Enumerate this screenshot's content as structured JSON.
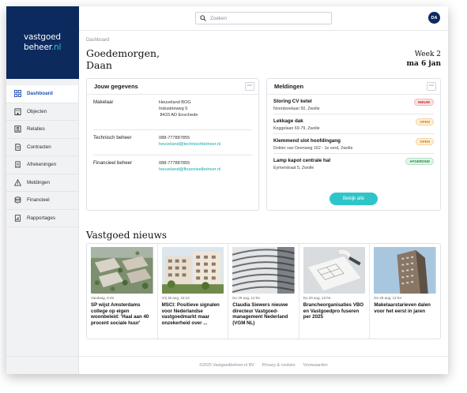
{
  "brand": {
    "line1": "vastgoed",
    "line2_main": "beheer",
    "line2_accent": ".nl"
  },
  "nav": [
    {
      "label": "Dashboard",
      "icon": "grid-icon",
      "active": true
    },
    {
      "label": "Objecten",
      "icon": "building-icon"
    },
    {
      "label": "Relaties",
      "icon": "contacts-icon"
    },
    {
      "label": "Contracten",
      "icon": "contract-icon"
    },
    {
      "label": "Afrekeningen",
      "icon": "receipt-icon"
    },
    {
      "label": "Meldingen",
      "icon": "warning-icon"
    },
    {
      "label": "Financieel",
      "icon": "coins-icon"
    },
    {
      "label": "Rapportages",
      "icon": "report-icon"
    }
  ],
  "search": {
    "placeholder": "Zoeken"
  },
  "user": {
    "initials": "DA"
  },
  "page": {
    "breadcrumb": "Dashboard",
    "greeting": "Goedemorgen, Daan",
    "week": "Week 2",
    "date": "ma 6 jan"
  },
  "gegevens": {
    "title": "Jouw gegevens",
    "more": "···",
    "rows": [
      {
        "label": "Makelaar",
        "lines": [
          "Heuveland BOG",
          "Industrieweg 5",
          " 8433 AD Enschede"
        ]
      },
      {
        "label": "Technisch beheer",
        "lines": [
          "088-777887855"
        ],
        "link": "heuveland@technischbeheer.nl"
      },
      {
        "label": "Financieel beheer",
        "lines": [
          "088-777887855"
        ],
        "link": "heuveland@financieelbeheer.nl"
      }
    ]
  },
  "meldingen": {
    "title": "Meldingen",
    "more": "···",
    "items": [
      {
        "title": "Storing CV ketel",
        "address": "Noordzeelaan 50, Zwolle",
        "status": "NIEUW",
        "status_color": "#c62828"
      },
      {
        "title": "Lekkage dak",
        "address": "Koggelaan 69-79, Zwolle",
        "status": "OPEN",
        "status_color": "#c98012"
      },
      {
        "title": "Klemmend slot hoofdingang",
        "address": "Dokter van Deenweg 162 - 1e verd, Zwolle",
        "status": "OPEN",
        "status_color": "#c98012"
      },
      {
        "title": "Lamp kapot centrale hal",
        "address": "Eymerstraat 5, Zwolle",
        "status": "AFGEROND",
        "status_color": "#1f8b43"
      }
    ],
    "cta": "Bekijk alle"
  },
  "news": {
    "title": "Vastgoed nieuws",
    "items": [
      {
        "date": "Vandaag, 9:46",
        "headline": "SP wijst Amsterdams college op eigen woonbeleid: 'Haal aan 40 procent sociale huur'"
      },
      {
        "date": "Vrij 30 aug, 18:12",
        "headline": "MSCI: Positieve signalen voor Nederlandse vastgoedmarkt maar onzekerheid over ..."
      },
      {
        "date": "Do 29 aug, 12:04",
        "headline": "Claudia Siewers nieuwe directeur Vastgoed-management Nederland (VGM NL)"
      },
      {
        "date": "Do 29 aug, 12:04",
        "headline": "Brancheorganisaties VBO en Vastgoedpro fuseren per 2025"
      },
      {
        "date": "Do 29 aug, 12:04",
        "headline": "Makelaarstarieven dalen voor het eerst in jaren"
      }
    ]
  },
  "footer": {
    "copyright": "©2025 Vastgoedbeheer.nl BV",
    "privacy": "Privacy & cookies",
    "terms": "Voorwaarden"
  },
  "colors": {
    "brand_navy": "#0c2a5e",
    "accent_teal": "#2ec5c9",
    "active_blue": "#1f4fb0"
  }
}
